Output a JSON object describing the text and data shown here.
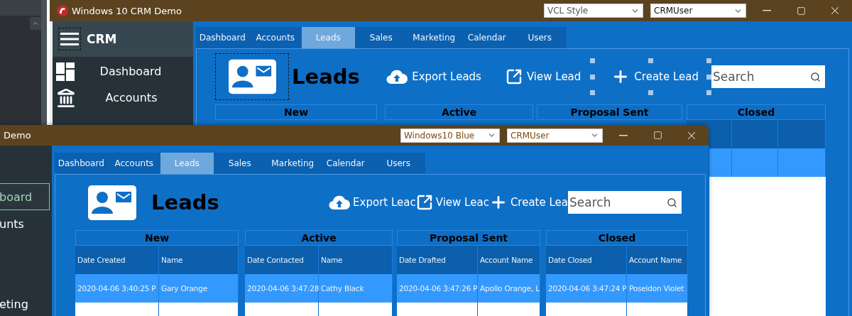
{
  "windows": [
    {
      "title": "Windows 10 CRM Demo",
      "style_select": "VCL Style",
      "user_select": "CRMUser",
      "sidebar": {
        "title": "CRM",
        "menu_selected": true,
        "items": [
          {
            "label": "Dashboard",
            "kind": "dashboard",
            "selected": false
          },
          {
            "label": "Accounts",
            "kind": "accounts",
            "selected": false
          }
        ]
      },
      "tabs": [
        {
          "label": "Dashboard",
          "selected": false
        },
        {
          "label": "Accounts",
          "selected": false
        },
        {
          "label": "Leads",
          "selected": true
        },
        {
          "label": "Sales",
          "selected": false
        },
        {
          "label": "Marketing",
          "selected": false
        },
        {
          "label": "Calendar",
          "selected": false
        },
        {
          "label": "Users",
          "selected": false
        }
      ],
      "page": {
        "title": "Leads",
        "logo_selected": true
      },
      "actions": [
        {
          "label": "Export Leads",
          "kind": "export",
          "selected": false
        },
        {
          "label": "View Lead",
          "kind": "view",
          "selected": false
        },
        {
          "label": "Create Lead",
          "kind": "create",
          "selected": true
        }
      ],
      "search": {
        "placeholder": "Search"
      },
      "grids": [
        {
          "title": "New"
        },
        {
          "title": "Active"
        },
        {
          "title": "Proposal Sent"
        },
        {
          "title": "Closed"
        }
      ]
    },
    {
      "title": "Demo",
      "style_select": "Windows10 Blue",
      "user_select": "CRMUser",
      "sidebar": {
        "items": [
          {
            "label": "board",
            "selected": true
          },
          {
            "label": "unts",
            "selected": false
          },
          {
            "label": "eting",
            "selected": false
          }
        ]
      },
      "tabs": [
        {
          "label": "Dashboard",
          "selected": false
        },
        {
          "label": "Accounts",
          "selected": false
        },
        {
          "label": "Leads",
          "selected": true
        },
        {
          "label": "Sales",
          "selected": false
        },
        {
          "label": "Marketing",
          "selected": false
        },
        {
          "label": "Calendar",
          "selected": false
        },
        {
          "label": "Users",
          "selected": false
        }
      ],
      "page": {
        "title": "Leads",
        "logo_selected": false
      },
      "actions": [
        {
          "label": "Export Leac",
          "kind": "export",
          "selected": false
        },
        {
          "label": "View Leac",
          "kind": "view",
          "selected": false
        },
        {
          "label": "Create Lea",
          "kind": "create",
          "selected": false
        }
      ],
      "search": {
        "placeholder": "Search"
      },
      "grids": [
        {
          "title": "New",
          "columns": [
            "Date Created",
            "Name"
          ],
          "rows": [
            {
              "selected": true,
              "cells": [
                "2020-04-06 3:40:25 P",
                "Gary Orange"
              ]
            },
            {
              "selected": false
            }
          ]
        },
        {
          "title": "Active",
          "columns": [
            "Date Contacted",
            "Name"
          ],
          "rows": [
            {
              "selected": true,
              "cells": [
                "2020-04-06 3:47:28",
                "Cathy Black"
              ]
            },
            {
              "selected": false
            }
          ]
        },
        {
          "title": "Proposal Sent",
          "columns": [
            "Date Drafted",
            "Account Name"
          ],
          "rows": [
            {
              "selected": true,
              "cells": [
                "2020-04-06 3:47:26 P",
                "Apollo Orange, L"
              ]
            }
          ]
        },
        {
          "title": "Closed",
          "columns": [
            "Date Closed",
            "Account Name"
          ],
          "rows": [
            {
              "selected": true,
              "cells": [
                "2020-04-06 3:47:24 P",
                "Poseidon Violet"
              ]
            },
            {
              "selected": false
            }
          ]
        }
      ]
    }
  ]
}
